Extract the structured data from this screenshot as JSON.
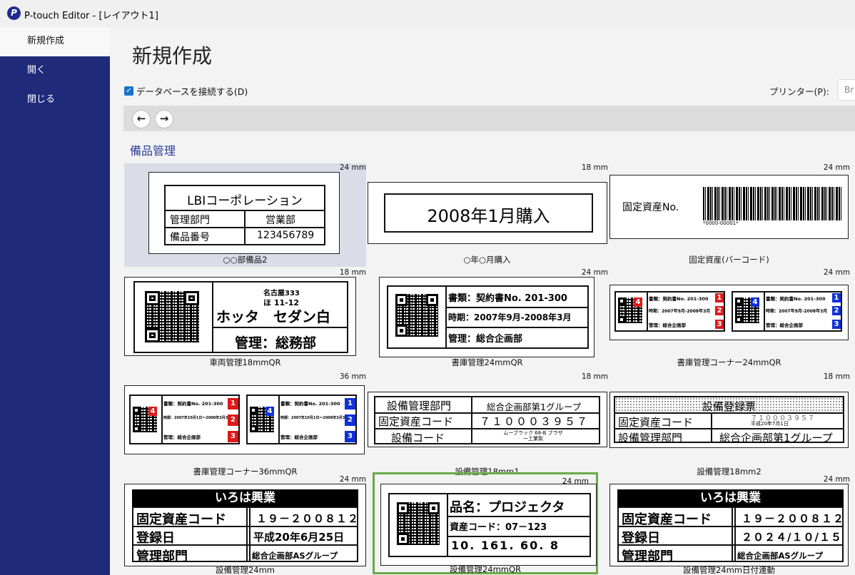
{
  "window": {
    "title": "P-touch Editor - [レイアウト1]",
    "logo": "P"
  },
  "sidebar": {
    "items": [
      {
        "label": "新規作成"
      },
      {
        "label": "開く"
      },
      {
        "label": "閉じる"
      }
    ]
  },
  "main": {
    "title": "新規作成",
    "db_checkbox": "データベースを接続する(D)",
    "db_checked_mark": "✓",
    "printer_label": "プリンター(P):",
    "printer_value": "Br",
    "nav_back": "←",
    "nav_forward": "→",
    "category": "備品管理"
  },
  "templates": [
    {
      "size": "24 mm",
      "caption": "○○部備品2",
      "content": {
        "company": "LBIコーポレーション",
        "r1a": "管理部門",
        "r1b": "営業部",
        "r2a": "備品番号",
        "r2b": "123456789"
      }
    },
    {
      "size": "18 mm",
      "caption": "○年○月購入",
      "content": {
        "text": "2008年1月購入"
      }
    },
    {
      "size": "24 mm",
      "caption": "固定資産(バーコード)",
      "content": {
        "text": "固定資産No.",
        "barcode_text": "*0000-00001*"
      }
    },
    {
      "size": "18 mm",
      "caption": "車両管理18mmQR",
      "content": {
        "place": "名古屋333",
        "plate": "ほ 11-12",
        "name": "ホッタ　セダン白",
        "dept": "管理：総務部"
      }
    },
    {
      "size": "24 mm",
      "caption": "書庫管理24mmQR",
      "content": {
        "r1": "書類：契約書No. 201-300",
        "r2": "時期：2007年9月-2008年3月",
        "r3": "管理：総合企画部"
      }
    },
    {
      "size": "24 mm",
      "caption": "書庫管理コーナー24mmQR",
      "content": {
        "r1": "書類：契約書No. 201-300",
        "r2": "時期：2007年9月-2008年3月",
        "r3": "管理：総合企画部",
        "badge_red": "4",
        "badge_blue": "4",
        "n1": "1",
        "n2": "2",
        "n3": "3"
      }
    },
    {
      "size": "36 mm",
      "caption": "書庫管理コーナー36mmQR",
      "content": {
        "r1": "書類：契約書No. 201-300",
        "r2": "時期：2007年10月1日～2008年3月31日",
        "r3": "管理：総合企画部",
        "badge_red": "4",
        "badge_blue": "4",
        "n1": "1",
        "n2": "2",
        "n3": "3"
      }
    },
    {
      "size": "18 mm",
      "caption": "設備管理18mm1",
      "content": {
        "r1a": "設備管理部門",
        "r1b": "総合企画部第1グループ",
        "r2a": "固定資産コード",
        "r2b": "７１０００３９５７",
        "r3a": "設備コード",
        "r3b": "ムーブラック 68-B ブラザー工業製"
      }
    },
    {
      "size": "18 mm",
      "caption": "設備管理18mm2",
      "content": {
        "head": "設備登録票",
        "r1a": "固定資産コード",
        "r1b": "７１０００３９５７",
        "r1c": "平成20年7月1日",
        "r2a": "設備管理部門",
        "r2b": "総合企画部第1グループ"
      }
    },
    {
      "size": "24 mm",
      "caption": "設備管理24mm",
      "content": {
        "head": "いろは興業",
        "r1a": "固定資産コード",
        "r1b": "１９－２００８１２",
        "r2a": "登録日",
        "r2b": "平成20年6月25日",
        "r3a": "管理部門",
        "r3b": "総合企画部ASグループ"
      }
    },
    {
      "size": "24 mm",
      "caption": "設備管理24mmQR",
      "content": {
        "r1": "品名：プロジェクタ",
        "r2": "資産コード：07－123",
        "r3": "10. 161. 60. 8"
      }
    },
    {
      "size": "24 mm",
      "caption": "設備管理24mm日付連動",
      "content": {
        "head": "いろは興業",
        "r1a": "固定資産コード",
        "r1b": "１９－２００８１２",
        "r2a": "登録日",
        "r2b": "２０２４/１０/１５",
        "r3a": "管理部門",
        "r3b": "総合企画部ASグループ"
      }
    }
  ],
  "colors": {
    "sidebar": "#1f2a7a",
    "selected_cell": "#dadce8",
    "highlight_border": "#6aaa4a",
    "badge_red": "#e01818",
    "badge_blue": "#1030d8",
    "category": "#2b3c9a"
  }
}
